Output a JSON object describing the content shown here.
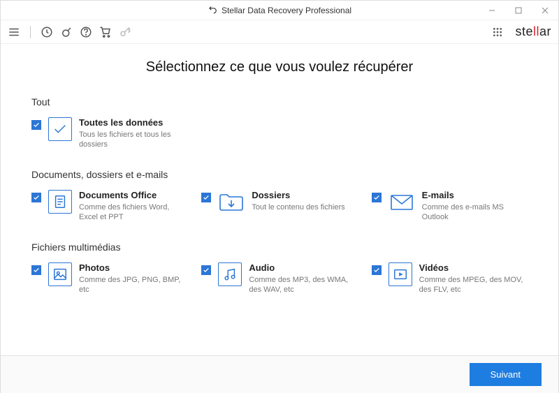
{
  "window": {
    "title": "Stellar Data Recovery Professional"
  },
  "brand": {
    "name_pre": "ste",
    "name_red": "ll",
    "name_post": "ar"
  },
  "heading": "Sélectionnez ce que vous voulez récupérer",
  "sections": {
    "all": {
      "title": "Tout",
      "item": {
        "title": "Toutes les données",
        "desc": "Tous les fichiers et tous les dossiers"
      }
    },
    "docs": {
      "title": "Documents, dossiers et e-mails",
      "office": {
        "title": "Documents Office",
        "desc": "Comme des fichiers Word, Excel et PPT"
      },
      "folders": {
        "title": "Dossiers",
        "desc": "Tout le contenu des fichiers"
      },
      "emails": {
        "title": "E-mails",
        "desc": "Comme des e-mails MS Outlook"
      }
    },
    "media": {
      "title": "Fichiers multimédias",
      "photos": {
        "title": "Photos",
        "desc": "Comme des JPG, PNG, BMP, etc"
      },
      "audio": {
        "title": "Audio",
        "desc": "Comme des MP3, des WMA, des WAV, etc"
      },
      "videos": {
        "title": "Vidéos",
        "desc": "Comme des MPEG, des MOV, des FLV, etc"
      }
    }
  },
  "footer": {
    "next": "Suivant"
  }
}
